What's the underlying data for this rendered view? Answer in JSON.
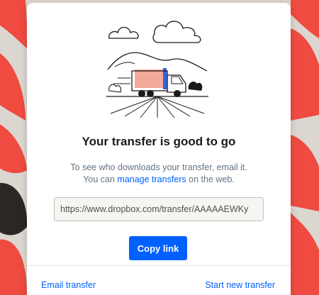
{
  "colors": {
    "accent": "#0061fe",
    "background_pattern": "#ef4b40",
    "card": "#ffffff",
    "title_text": "#1e1919",
    "muted_text": "#637282",
    "truck_highlight_pink": "#f4a99a",
    "truck_highlight_blue": "#2f62f2"
  },
  "illustration": {
    "icon": "delivery-truck-landscape-illustration"
  },
  "dialog": {
    "title": "Your transfer is good to go",
    "description_line1": "To see who downloads your transfer, email it.",
    "description_line2_prefix": "You can ",
    "description_link": "manage transfers",
    "description_line2_suffix": " on the web."
  },
  "share": {
    "url": "https://www.dropbox.com/transfer/AAAAAEWKy",
    "copy_label": "Copy link"
  },
  "footer": {
    "email_label": "Email transfer",
    "new_label": "Start new transfer"
  }
}
